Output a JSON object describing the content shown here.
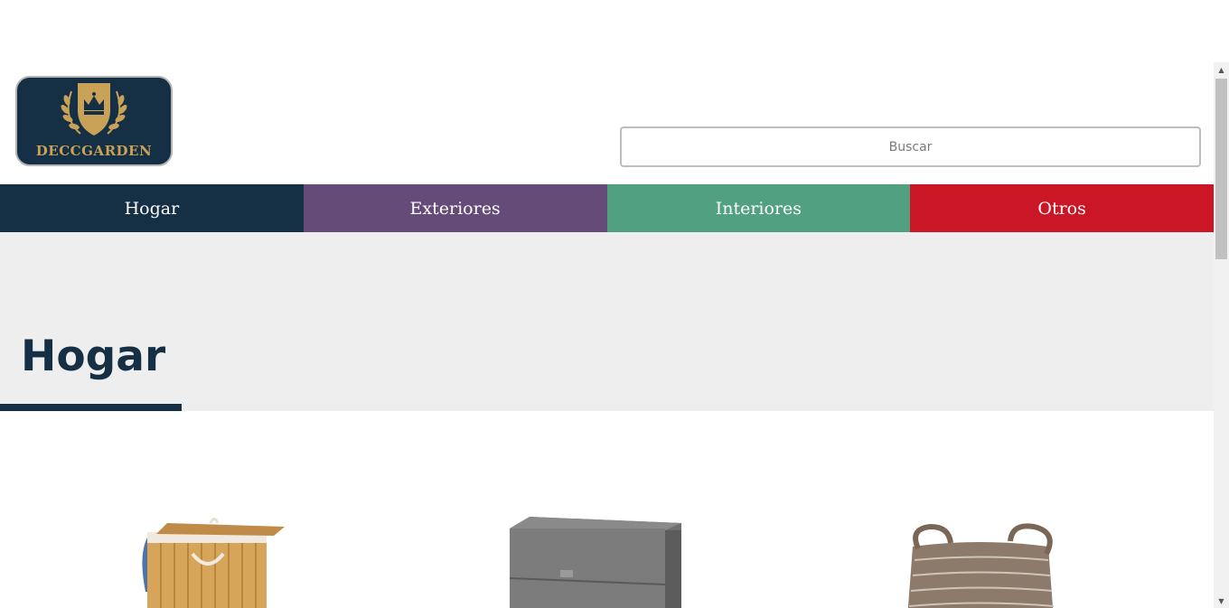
{
  "brand": {
    "name": "DECCGARDEN"
  },
  "search": {
    "placeholder": "Buscar"
  },
  "nav": {
    "items": [
      {
        "label": "Hogar",
        "color": "#152f45"
      },
      {
        "label": "Exteriores",
        "color": "#654b77"
      },
      {
        "label": "Interiores",
        "color": "#51a180"
      },
      {
        "label": "Otros",
        "color": "#cb1725"
      }
    ]
  },
  "page": {
    "title": "Hogar"
  },
  "products": [
    {
      "icon": "bamboo-laundry-hamper-image"
    },
    {
      "icon": "gray-drawer-unit-image"
    },
    {
      "icon": "brown-woven-basket-image"
    }
  ],
  "colors": {
    "accent": "#152f45",
    "band": "#eeeeee",
    "gold": "#c9a257"
  }
}
